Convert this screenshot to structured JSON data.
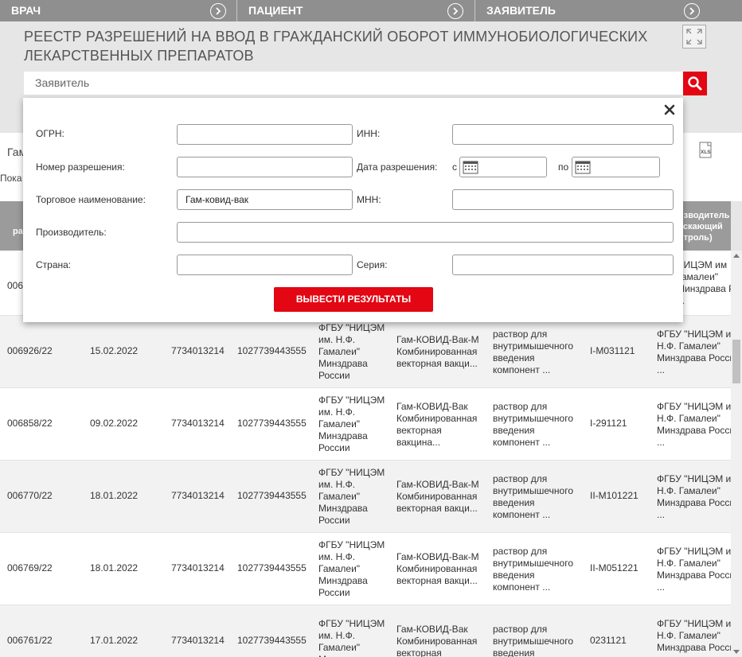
{
  "topnav": {
    "tabs": [
      {
        "label": "ВРАЧ"
      },
      {
        "label": "ПАЦИЕНТ"
      },
      {
        "label": "ЗАЯВИТЕЛЬ"
      }
    ]
  },
  "header": {
    "title_line1": "РЕЕСТР РАЗРЕШЕНИЙ НА ВВОД В ГРАЖДАНСКИЙ ОБОРОТ ИММУНОБИОЛОГИЧЕСКИХ",
    "title_line2": "ЛЕКАРСТВЕННЫХ ПРЕПАРАТОВ",
    "search_placeholder": "Заявитель"
  },
  "background": {
    "partial_text1": "Гам",
    "partial_text2": "Пока",
    "header_left_partial": "ра",
    "header_right_partial": [
      "изводитель",
      "ускающий",
      "нтроль)"
    ]
  },
  "table": {
    "rows": [
      {
        "num": "006",
        "date": "",
        "inn": "",
        "ogrn": "",
        "holder": [],
        "trade": [],
        "form": [],
        "series": "",
        "mfr": [
          "НИЦЭМ им",
          "Гамалеи\"",
          "Минздрава России",
          "..."
        ]
      },
      {
        "num": "006926/22",
        "date": "15.02.2022",
        "inn": "7734013214",
        "ogrn": "1027739443555",
        "holder": [
          "ФГБУ \"НИЦЭМ",
          "им. Н.Ф.",
          "Гамалеи\"",
          "Минздрава",
          "России"
        ],
        "trade": [
          "Гам-КОВИД-Вак-М",
          "Комбинированная",
          "векторная вакци..."
        ],
        "form": [
          "раствор для",
          "внутримышечного",
          "введения",
          "компонент ..."
        ],
        "series": "I-M031121",
        "mfr": [
          "ФГБУ \"НИЦЭМ им",
          "Н.Ф. Гамалеи\"",
          "Минздрава Росси",
          "..."
        ]
      },
      {
        "num": "006858/22",
        "date": "09.02.2022",
        "inn": "7734013214",
        "ogrn": "1027739443555",
        "holder": [
          "ФГБУ \"НИЦЭМ",
          "им. Н.Ф.",
          "Гамалеи\"",
          "Минздрава",
          "России"
        ],
        "trade": [
          "Гам-КОВИД-Вак",
          "Комбинированная",
          "векторная",
          "вакцина..."
        ],
        "form": [
          "раствор для",
          "внутримышечного",
          "введения",
          "компонент ..."
        ],
        "series": "I-291121",
        "mfr": [
          "ФГБУ \"НИЦЭМ им",
          "Н.Ф. Гамалеи\"",
          "Минздрава Росси",
          "..."
        ]
      },
      {
        "num": "006770/22",
        "date": "18.01.2022",
        "inn": "7734013214",
        "ogrn": "1027739443555",
        "holder": [
          "ФГБУ \"НИЦЭМ",
          "им. Н.Ф.",
          "Гамалеи\"",
          "Минздрава",
          "России"
        ],
        "trade": [
          "Гам-КОВИД-Вак-М",
          "Комбинированная",
          "векторная вакци..."
        ],
        "form": [
          "раствор для",
          "внутримышечного",
          "введения",
          "компонент ..."
        ],
        "series": "II-M101221",
        "mfr": [
          "ФГБУ \"НИЦЭМ им",
          "Н.Ф. Гамалеи\"",
          "Минздрава Росси",
          "..."
        ]
      },
      {
        "num": "006769/22",
        "date": "18.01.2022",
        "inn": "7734013214",
        "ogrn": "1027739443555",
        "holder": [
          "ФГБУ \"НИЦЭМ",
          "им. Н.Ф.",
          "Гамалеи\"",
          "Минздрава",
          "России"
        ],
        "trade": [
          "Гам-КОВИД-Вак-М",
          "Комбинированная",
          "векторная вакци..."
        ],
        "form": [
          "раствор для",
          "внутримышечного",
          "введения",
          "компонент ..."
        ],
        "series": "II-M051221",
        "mfr": [
          "ФГБУ \"НИЦЭМ им",
          "Н.Ф. Гамалеи\"",
          "Минздрава Росси",
          "..."
        ]
      },
      {
        "num": "006761/22",
        "date": "17.01.2022",
        "inn": "7734013214",
        "ogrn": "1027739443555",
        "holder": [
          "ФГБУ \"НИЦЭМ",
          "им. Н.Ф.",
          "Гамалеи\"",
          "Минздрава"
        ],
        "trade": [
          "Гам-КОВИД-Вак",
          "Комбинированная",
          "векторная"
        ],
        "form": [
          "раствор для",
          "внутримышечного",
          "введения"
        ],
        "series": "0231121",
        "mfr": [
          "ФГБУ \"НИЦЭМ им",
          "Н.Ф. Гамалеи\"",
          "Минздрава Росси",
          "..."
        ]
      }
    ]
  },
  "filter": {
    "ogrn_label": "ОГРН:",
    "ogrn_value": "",
    "inn_label": "ИНН:",
    "inn_value": "",
    "permit_num_label": "Номер разрешения:",
    "permit_num_value": "",
    "permit_date_label": "Дата разрешения:",
    "date_from_label": "с",
    "date_from_value": "",
    "date_to_label": "по",
    "date_to_value": "",
    "trade_name_label": "Торговое наименование:",
    "trade_name_value": "Гам-ковид-вак",
    "inn_name_label": "МНН:",
    "inn_name_value": "",
    "manufacturer_label": "Производитель:",
    "manufacturer_value": "",
    "country_label": "Страна:",
    "country_value": "",
    "series_label": "Серия:",
    "series_value": "",
    "submit_label": "ВЫВЕСТИ РЕЗУЛЬТАТЫ"
  },
  "colors": {
    "accent": "#e30613",
    "nav_bg": "#8f8f8f",
    "table_header_bg": "#9b9b9b"
  },
  "icons": [
    "chevron-right-icon",
    "expand-icon",
    "search-icon",
    "close-icon",
    "calendar-icon",
    "xls-icon"
  ]
}
